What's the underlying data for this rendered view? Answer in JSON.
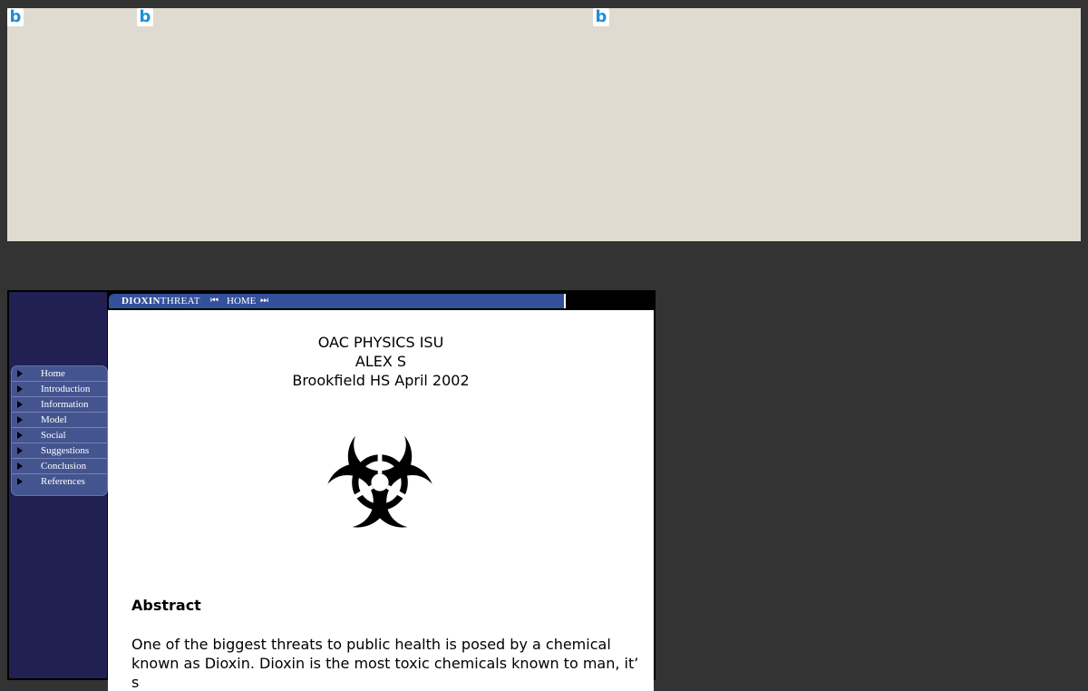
{
  "page": {
    "background_color": "#333333",
    "top_panel_color": "#dfdbd0",
    "broken_image_icons": [
      "b",
      "b",
      "b"
    ]
  },
  "site": {
    "topbar": {
      "brand_bold": "DIOXIN",
      "brand_rest": "THREAT",
      "prev_icon": "⏮",
      "home_label": "HOME",
      "next_icon": "⏭",
      "bar_color": "#33509a"
    },
    "nav": {
      "items": [
        {
          "label": "Home"
        },
        {
          "label": "Introduction"
        },
        {
          "label": "Information"
        },
        {
          "label": "Model"
        },
        {
          "label": "Social"
        },
        {
          "label": "Suggestions"
        },
        {
          "label": "Conclusion"
        },
        {
          "label": "References"
        }
      ],
      "sidebar_color": "#202052",
      "menu_color": "#44548f"
    },
    "header": {
      "line1": "OAC PHYSICS ISU",
      "line2": "ALEX S",
      "line3": "Brookfield HS April 2002"
    },
    "image_icon": "biohazard-icon",
    "abstract": {
      "title": "Abstract",
      "text": "One of the biggest threats to public health is posed by a chemical known as Dioxin. Dioxin is the most toxic chemicals known to man, it’ s"
    }
  }
}
